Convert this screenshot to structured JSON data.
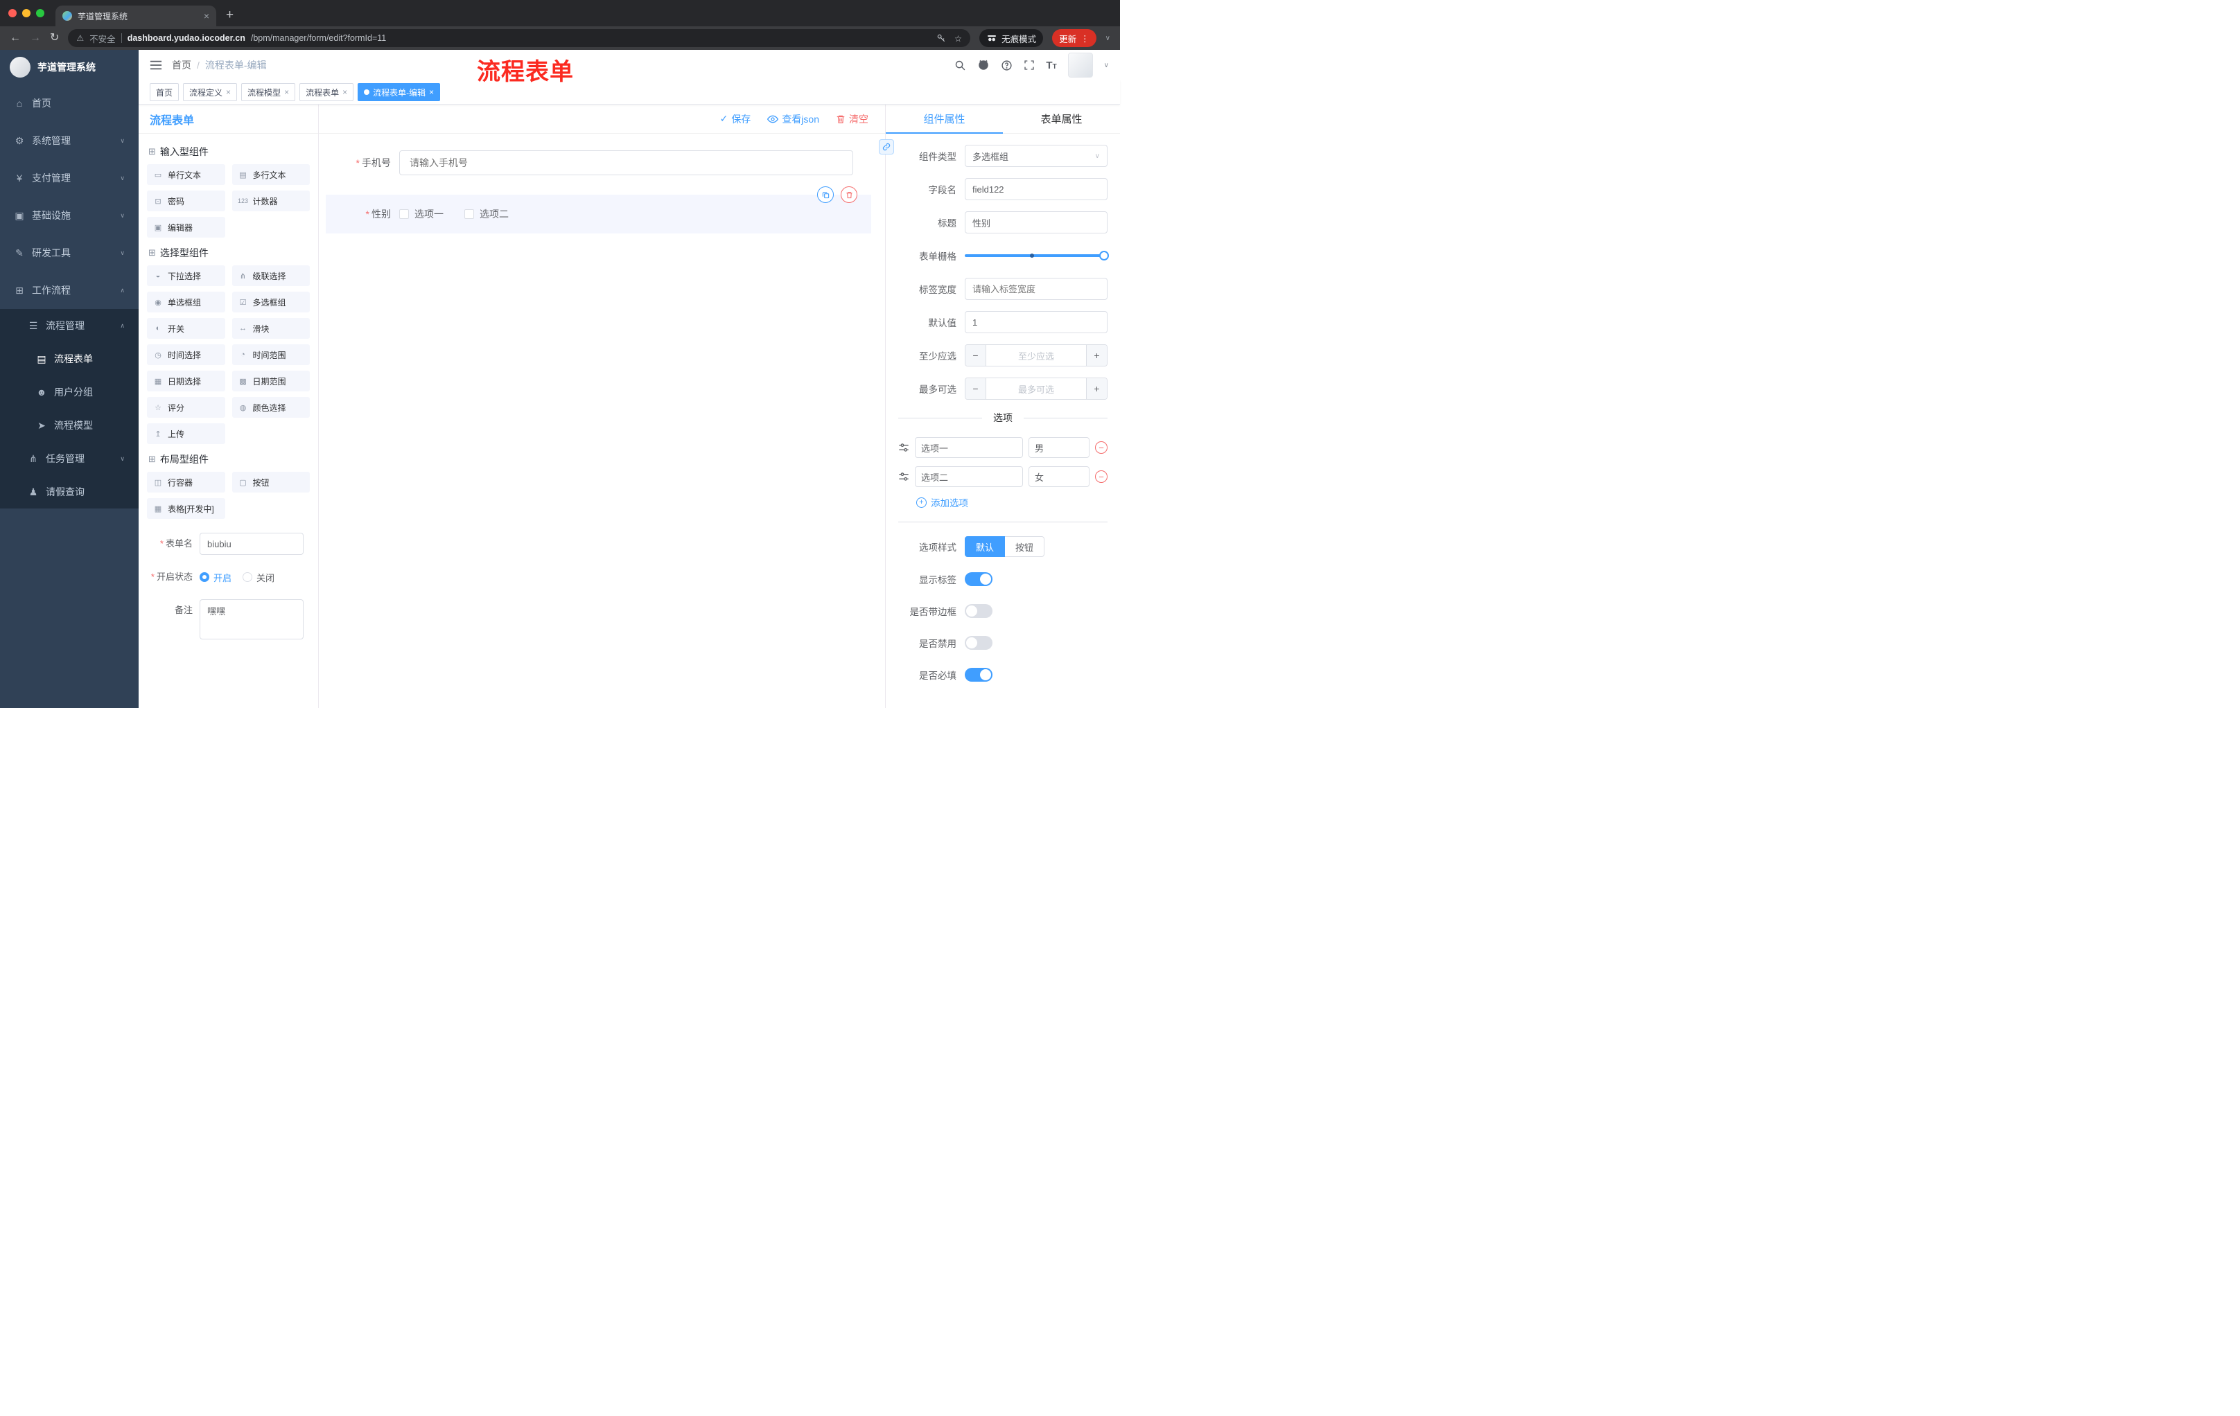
{
  "glyphs": {
    "close": "×",
    "plus": "+",
    "back": "←",
    "forward": "→",
    "reload": "↻",
    "warn": "⚠",
    "star": "☆",
    "kebab": "⋮",
    "caret_down": "∨",
    "caret_up": "∧",
    "slash": "/",
    "check": "✓",
    "minus": "−"
  },
  "colors": {
    "accent": "#409eff",
    "danger": "#f56c6c",
    "sidebar_bg": "#304156",
    "submenu_bg": "#1f2d3d",
    "watermark_red": "#fb2a20",
    "update_pill": "#d93025"
  },
  "chrome": {
    "tab_title": "芋道管理系统",
    "security_label": "不安全",
    "url_domain": "dashboard.yudao.iocoder.cn",
    "url_path": "/bpm/manager/form/edit?formId=11",
    "incognito_label": "无痕模式",
    "update_label": "更新"
  },
  "sidebar": {
    "logo_title": "芋道管理系统",
    "items": [
      {
        "icon": "⌂",
        "label": "首页"
      },
      {
        "icon": "⚙",
        "label": "系统管理",
        "arrow": "∨"
      },
      {
        "icon": "¥",
        "label": "支付管理",
        "arrow": "∨"
      },
      {
        "icon": "▣",
        "label": "基础设施",
        "arrow": "∨"
      },
      {
        "icon": "✎",
        "label": "研发工具",
        "arrow": "∨"
      },
      {
        "icon": "⊞",
        "label": "工作流程",
        "arrow": "∧"
      }
    ],
    "submenu": {
      "group": {
        "icon": "☰",
        "label": "流程管理",
        "arrow": "∧"
      },
      "children": [
        {
          "icon": "▤",
          "label": "流程表单"
        },
        {
          "icon": "☻",
          "label": "用户分组"
        },
        {
          "icon": "➤",
          "label": "流程模型"
        }
      ],
      "tasks": {
        "icon": "⋔",
        "label": "任务管理",
        "arrow": "∨"
      },
      "leave": {
        "icon": "♟",
        "label": "请假查询"
      }
    }
  },
  "header": {
    "breadcrumb": {
      "home": "首页",
      "current": "流程表单-编辑"
    },
    "watermark": "流程表单"
  },
  "tags": [
    {
      "label": "首页"
    },
    {
      "label": "流程定义"
    },
    {
      "label": "流程模型"
    },
    {
      "label": "流程表单"
    },
    {
      "label": "流程表单-编辑"
    }
  ],
  "designer": {
    "panel_title": "流程表单",
    "toolbar": {
      "save": "保存",
      "view_json": "查看json",
      "clear": "清空"
    },
    "palette": {
      "groups": [
        {
          "icon": "⊞",
          "title": "输入型组件",
          "items": [
            {
              "icon": "▭",
              "label": "单行文本"
            },
            {
              "icon": "▤",
              "label": "多行文本"
            },
            {
              "icon": "⊡",
              "label": "密码"
            },
            {
              "icon": "123",
              "label": "计数器"
            },
            {
              "icon": "▣",
              "label": "编辑器"
            }
          ]
        },
        {
          "icon": "⊞",
          "title": "选择型组件",
          "items": [
            {
              "icon": "◒",
              "label": "下拉选择"
            },
            {
              "icon": "⋔",
              "label": "级联选择"
            },
            {
              "icon": "◉",
              "label": "单选框组"
            },
            {
              "icon": "☑",
              "label": "多选框组"
            },
            {
              "icon": "◐",
              "label": "开关"
            },
            {
              "icon": "↔",
              "label": "滑块"
            },
            {
              "icon": "◷",
              "label": "时间选择"
            },
            {
              "icon": "◔",
              "label": "时间范围"
            },
            {
              "icon": "▦",
              "label": "日期选择"
            },
            {
              "icon": "▩",
              "label": "日期范围"
            },
            {
              "icon": "☆",
              "label": "评分"
            },
            {
              "icon": "◍",
              "label": "颜色选择"
            },
            {
              "icon": "↥",
              "label": "上传"
            }
          ]
        },
        {
          "icon": "⊞",
          "title": "布局型组件",
          "items": [
            {
              "icon": "◫",
              "label": "行容器"
            },
            {
              "icon": "▢",
              "label": "按钮"
            },
            {
              "icon": "▦",
              "label": "表格[开发中]"
            }
          ]
        }
      ]
    },
    "meta": {
      "name_label": "表单名",
      "name_value": "biubiu",
      "status_label": "开启状态",
      "status_on": "开启",
      "status_off": "关闭",
      "remark_label": "备注",
      "remark_value": "嘿嘿"
    },
    "canvas": {
      "phone": {
        "label": "手机号",
        "placeholder": "请输入手机号"
      },
      "gender": {
        "label": "性别",
        "opt1": "选项一",
        "opt2": "选项二"
      }
    }
  },
  "props": {
    "tab_component": "组件属性",
    "tab_form": "表单属性",
    "type_label": "组件类型",
    "type_value": "多选框组",
    "field_label": "字段名",
    "field_value": "field122",
    "title_label": "标题",
    "title_value": "性别",
    "grid_label": "表单栅格",
    "labelw_label": "标签宽度",
    "labelw_placeholder": "请输入标签宽度",
    "default_label": "默认值",
    "default_value": "1",
    "min_label": "至少应选",
    "min_placeholder": "至少应选",
    "max_label": "最多可选",
    "max_placeholder": "最多可选",
    "options_title": "选项",
    "options": [
      {
        "label": "选项一",
        "value": "男"
      },
      {
        "label": "选项二",
        "value": "女"
      }
    ],
    "add_option": "添加选项",
    "style_label": "选项样式",
    "style_default": "默认",
    "style_button": "按钮",
    "switches": [
      {
        "label": "显示标签",
        "on": true
      },
      {
        "label": "是否带边框",
        "on": false
      },
      {
        "label": "是否禁用",
        "on": false
      },
      {
        "label": "是否必填",
        "on": true
      }
    ]
  }
}
